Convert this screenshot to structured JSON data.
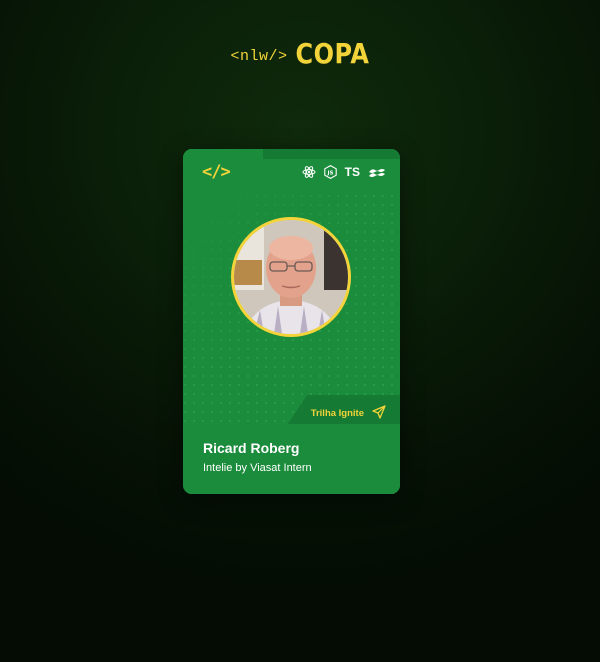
{
  "brand": {
    "code_tag": "<nlw/>",
    "event_name": "COPA"
  },
  "card": {
    "code_icon": "</>",
    "tech_icons": [
      "react-icon",
      "nodejs-icon",
      "ts-label",
      "tailwind-icon"
    ],
    "ts_label": "TS",
    "trail_label": "Trilha Ignite",
    "trail_icon": "rocket-icon",
    "name": "Ricard Roberg",
    "role": "Intelie by Viasat Intern",
    "avatar_icon": "profile-photo"
  },
  "colors": {
    "background": "#0a1f08",
    "card_green": "#1b8b3c",
    "card_dark_green": "#157a33",
    "accent_yellow": "#f2d43a",
    "text_white": "#ffffff"
  }
}
